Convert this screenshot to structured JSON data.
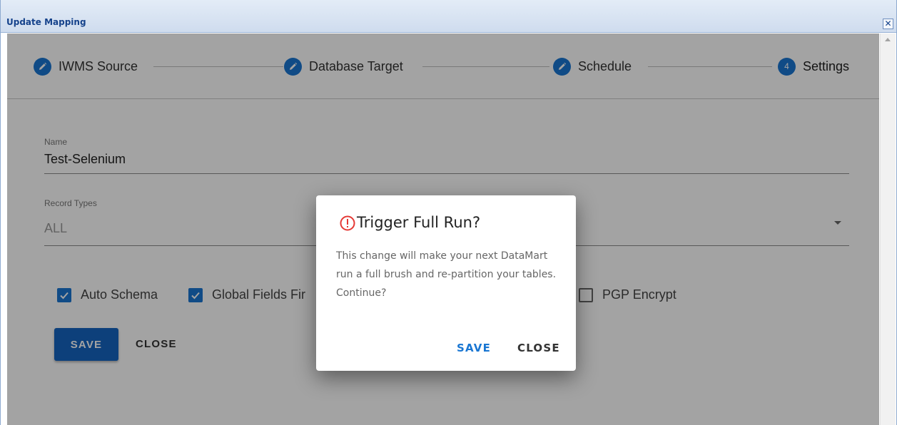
{
  "window": {
    "title": "Update Mapping",
    "close_glyph": "✕"
  },
  "stepper": {
    "steps": [
      {
        "label": "IWMS Source",
        "icon": "pencil-icon"
      },
      {
        "label": "Database Target",
        "icon": "pencil-icon"
      },
      {
        "label": "Schedule",
        "icon": "pencil-icon"
      },
      {
        "label": "Settings",
        "number": "4"
      }
    ],
    "accent_color": "#1976d2"
  },
  "form": {
    "name": {
      "label": "Name",
      "value": "Test-Selenium"
    },
    "record_types": {
      "label": "Record Types",
      "value": "ALL"
    },
    "options": [
      {
        "label": "Auto Schema",
        "checked": true
      },
      {
        "label": "Global Fields Fir",
        "checked": true
      },
      {
        "label": "PGP Encrypt",
        "checked": false
      }
    ],
    "save_label": "SAVE",
    "close_label": "CLOSE"
  },
  "dialog": {
    "title": "Trigger Full Run?",
    "body": "This change will make your next DataMart run a full brush and re-partition your tables. Continue?",
    "save_label": "SAVE",
    "close_label": "CLOSE",
    "warning_color": "#e53935"
  }
}
